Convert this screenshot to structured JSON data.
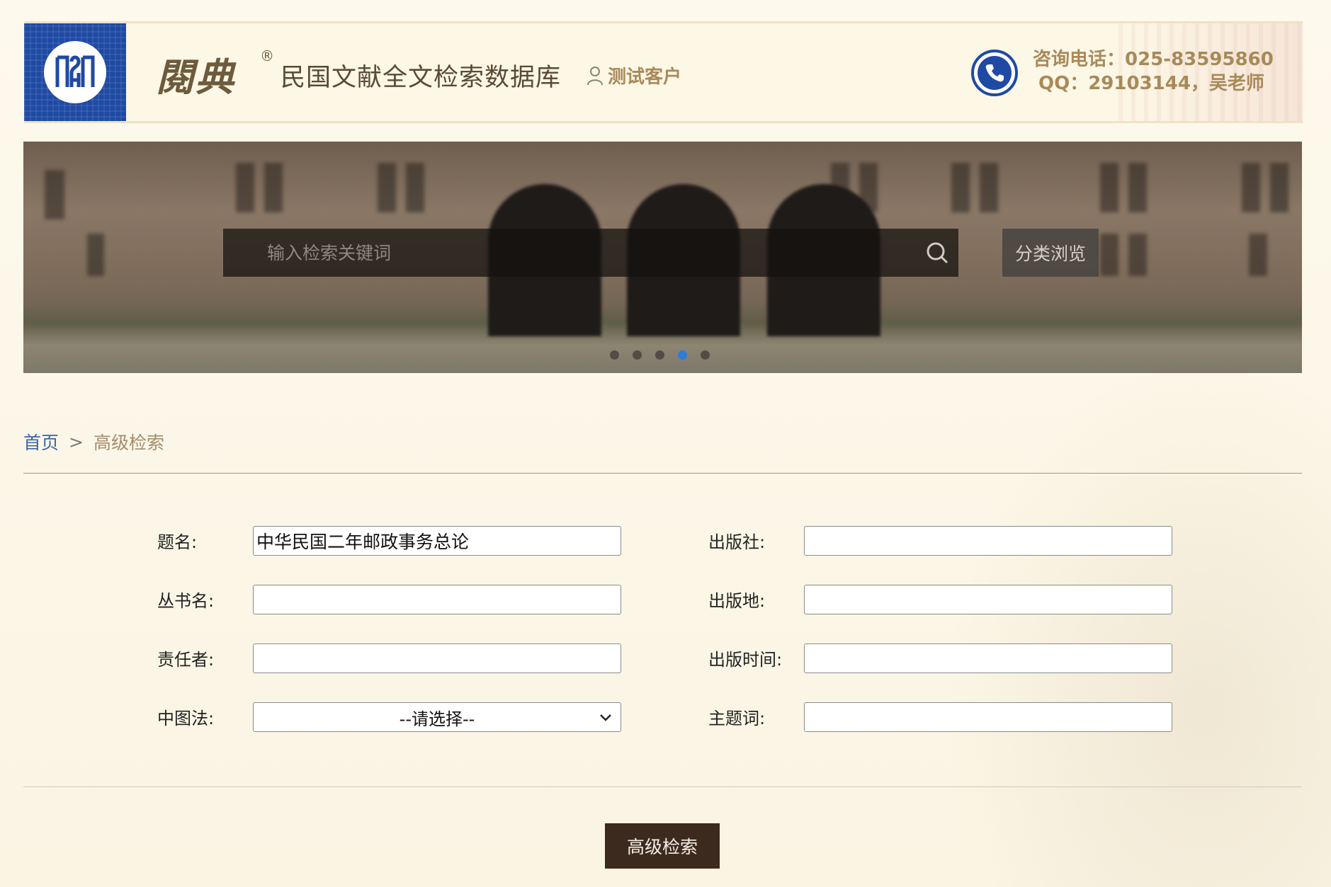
{
  "header": {
    "brand_calligraphy": "閱典",
    "brand_registered": "®",
    "brand_title": "民国文献全文检索数据库",
    "user_label": "测试客户",
    "contact_phone": "咨询电话：025-83595860",
    "contact_qq": "QQ：29103144，吴老师"
  },
  "banner": {
    "search_placeholder": "输入检索关键词",
    "category_label": "分类浏览",
    "slides_count_visible": 5,
    "active_slide": 4
  },
  "breadcrumb": {
    "home": "首页",
    "separator": ">",
    "current": "高级检索"
  },
  "form": {
    "title_label": "题名:",
    "title_value": "中华民国二年邮政事务总论",
    "series_label": "丛书名:",
    "series_value": "",
    "author_label": "责任者:",
    "author_value": "",
    "clc_label": "中图法:",
    "clc_selected": "--请选择--",
    "publisher_label": "出版社:",
    "publisher_value": "",
    "place_label": "出版地:",
    "place_value": "",
    "date_label": "出版时间:",
    "date_value": "",
    "subject_label": "主题词:",
    "subject_value": ""
  },
  "actions": {
    "submit_label": "高级检索"
  },
  "colors": {
    "logo_blue": "#1f4aa3",
    "brand_brown": "#6e5a3c",
    "accent_tan": "#a88a5a",
    "link_blue": "#3a64a8",
    "button_dark": "#3d2a1f",
    "active_dot": "#2f7bd8",
    "page_bg": "#fcf8ea"
  }
}
